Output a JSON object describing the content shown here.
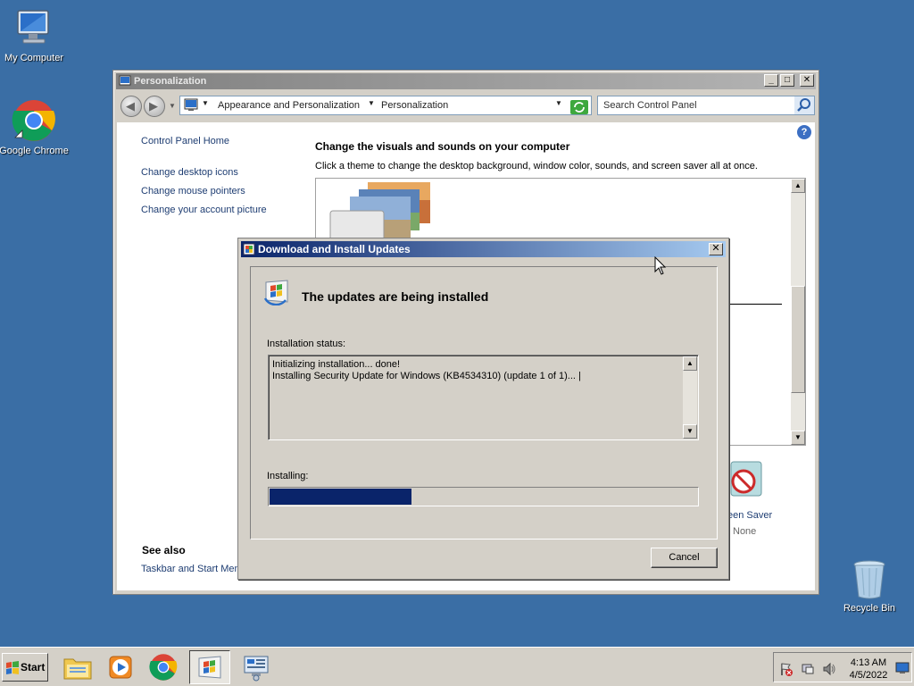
{
  "desktop": {
    "icons": [
      {
        "label": "My Computer"
      },
      {
        "label": "Google Chrome"
      },
      {
        "label": "Recycle Bin"
      }
    ]
  },
  "window": {
    "title": "Personalization",
    "breadcrumbs": [
      "Appearance and Personalization",
      "Personalization"
    ],
    "search_placeholder": "Search Control Panel",
    "left_nav": {
      "home": "Control Panel Home",
      "links": [
        "Change desktop icons",
        "Change mouse pointers",
        "Change your account picture"
      ],
      "see_also_heading": "See also",
      "see_also_links": [
        "Taskbar and Start Men"
      ]
    },
    "main": {
      "heading": "Change the visuals and sounds on your computer",
      "description": "Click a theme to change the desktop background, window color, sounds, and screen saver all at once.",
      "screen_saver_label": "een Saver",
      "screen_saver_value": "None"
    }
  },
  "dialog": {
    "title": "Download and Install Updates",
    "heading": "The updates are being installed",
    "status_label": "Installation status:",
    "log_lines": [
      "Initializing installation... done!",
      "Installing Security Update for Windows (KB4534310) (update 1 of 1)... |"
    ],
    "progress_label": "Installing:",
    "progress_fraction": 0.33,
    "cancel_label": "Cancel"
  },
  "taskbar": {
    "start_label": "Start",
    "time": "4:13 AM",
    "date": "4/5/2022",
    "pinned": [
      "explorer-icon",
      "media-player-icon",
      "chrome-icon",
      "windows-update-icon",
      "network-monitor-icon"
    ]
  },
  "colors": {
    "desktop": "#3a6ea5",
    "dialog_title": "#0a246a",
    "progress_fill": "#0a246a"
  }
}
